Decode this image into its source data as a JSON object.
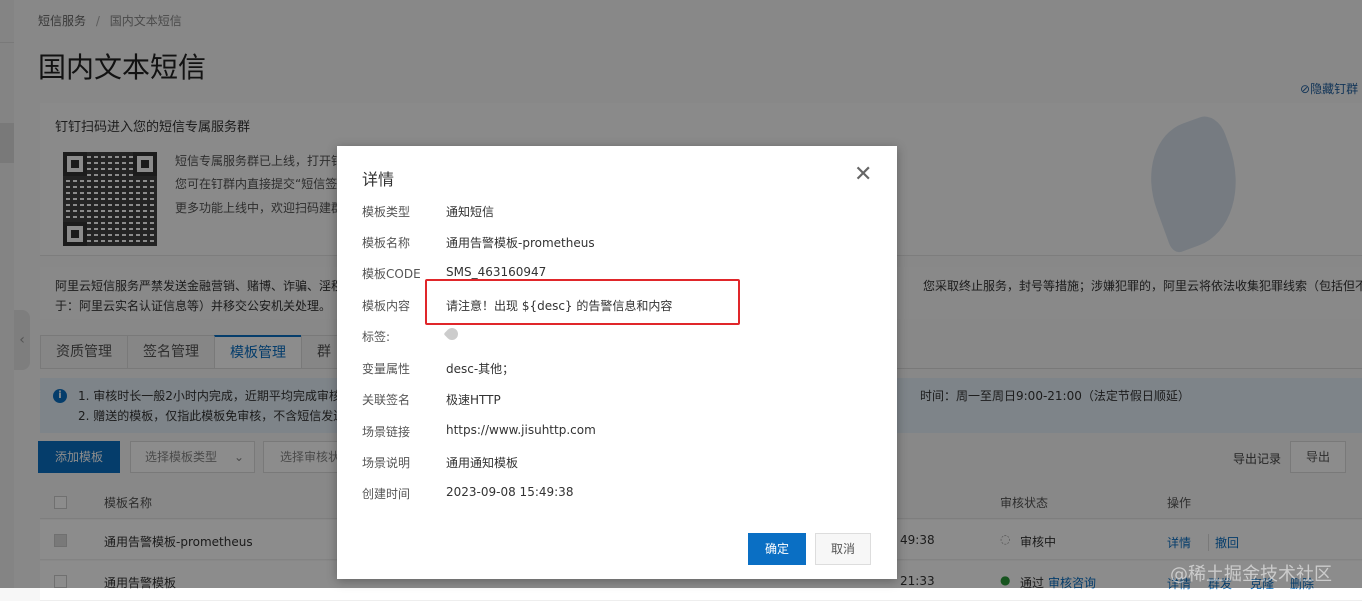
{
  "breadcrumb": {
    "root": "短信服务",
    "sep": "/",
    "current": "国内文本短信"
  },
  "page_title": "国内文本短信",
  "hide_group_link": "隐藏钉群",
  "dingtalk_card": {
    "heading": "钉钉扫码进入您的短信专属服务群",
    "lines": [
      "短信专属服务群已上线，打开钉",
      "您可在钉群内直接提交“短信签名",
      "更多功能上线中，欢迎扫码建群"
    ]
  },
  "warning": {
    "line1_left": "阿里云短信服务严禁发送金融营销、赌博、诈骗、淫秽",
    "line1_right": "您采取终止服务，封号等措施；涉嫌犯罪的，阿里云将依法收集犯罪线索（包括但不限",
    "line2": "于：阿里云实名认证信息等）并移交公安机关处理。"
  },
  "tabs": [
    {
      "label": "资质管理"
    },
    {
      "label": "签名管理"
    },
    {
      "label": "模板管理",
      "active": true
    },
    {
      "label": "群"
    }
  ],
  "info": {
    "line1": "1. 审核时长一般2小时内完成，近期平均完成审核",
    "line2": "2. 赠送的模板，仅指此模板免审核，不含短信发送",
    "line1_right": "时间：周一至周日9:00-21:00（法定节假日顺延）"
  },
  "toolbar": {
    "add": "添加模板",
    "type_select": "选择模板类型",
    "status_select": "选择审核状",
    "export_records": "导出记录",
    "export": "导出"
  },
  "table": {
    "headers": {
      "name": "模板名称",
      "status": "审核状态",
      "action": "操作"
    },
    "rows": [
      {
        "name": "通用告警模板-prometheus",
        "time_tail": "49:38",
        "status": "审核中",
        "actions": [
          "详情",
          "撤回"
        ]
      },
      {
        "name": "通用告警模板",
        "time_tail": "21:33",
        "status": "通过",
        "status_link": "审核咨询",
        "actions": [
          "详情",
          "群发",
          "克隆",
          "删除"
        ]
      }
    ]
  },
  "modal": {
    "title": "详情",
    "fields": [
      {
        "label": "模板类型",
        "value": "通知短信"
      },
      {
        "label": "模板名称",
        "value": "通用告警模板-prometheus"
      },
      {
        "label": "模板CODE",
        "value": "SMS_463160947"
      },
      {
        "label": "模板内容",
        "value": "请注意！出现 ${desc} 的告警信息和内容"
      },
      {
        "label": "标签:",
        "value": ""
      },
      {
        "label": "变量属性",
        "value": "desc-其他；"
      },
      {
        "label": "关联签名",
        "value": "极速HTTP"
      },
      {
        "label": "场景链接",
        "value": "https://www.jisuhttp.com"
      },
      {
        "label": "场景说明",
        "value": "通用通知模板"
      },
      {
        "label": "创建时间",
        "value": "2023-09-08 15:49:38"
      }
    ],
    "ok": "确定",
    "cancel": "取消"
  },
  "watermark": "@稀土掘金技术社区",
  "colors": {
    "primary": "#0a6fc4",
    "highlight_box": "#e0262a"
  }
}
